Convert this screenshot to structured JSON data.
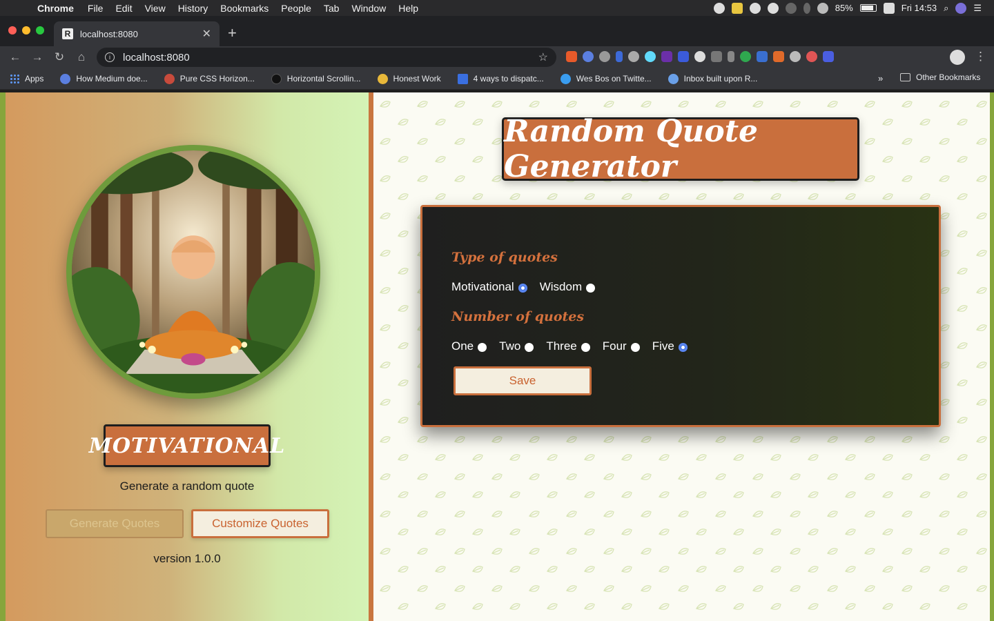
{
  "menubar": {
    "app_name": "Chrome",
    "items": [
      "File",
      "Edit",
      "View",
      "History",
      "Bookmarks",
      "People",
      "Tab",
      "Window",
      "Help"
    ],
    "battery_percent": "85%",
    "clock": "Fri 14:53"
  },
  "browser": {
    "tab_title": "localhost:8080",
    "tab_favicon": "R",
    "url": "localhost:8080",
    "bookmarks": [
      {
        "label": "Apps",
        "color": "#5e97f6"
      },
      {
        "label": "How Medium doe...",
        "color": "#5b7fe0"
      },
      {
        "label": "Pure CSS Horizon...",
        "color": "#c84b3c"
      },
      {
        "label": "Horizontal Scrollin...",
        "color": "#111111"
      },
      {
        "label": "Honest Work",
        "color": "#e8b83a"
      },
      {
        "label": "4 ways to dispatc...",
        "color": "#3a6fe0"
      },
      {
        "label": "Wes Bos on Twitte...",
        "color": "#3a9df0"
      },
      {
        "label": "Inbox built upon R...",
        "color": "#6aa0e8"
      }
    ],
    "other_bookmarks": "Other Bookmarks",
    "more_bookmarks_icon": "»"
  },
  "sidebar": {
    "category_badge": "Motivational",
    "tagline": "Generate a random quote",
    "generate_button": "Generate Quotes",
    "customize_button": "Customize Quotes",
    "version": "version 1.0.0"
  },
  "main": {
    "title": "Random Quote Generator",
    "type_label": "Type of quotes",
    "type_options": [
      {
        "label": "Motivational",
        "selected": true
      },
      {
        "label": "Wisdom",
        "selected": false
      }
    ],
    "number_label": "Number of quotes",
    "number_options": [
      {
        "label": "One",
        "selected": false
      },
      {
        "label": "Two",
        "selected": false
      },
      {
        "label": "Three",
        "selected": false
      },
      {
        "label": "Four",
        "selected": false
      },
      {
        "label": "Five",
        "selected": true
      }
    ],
    "save_button": "Save"
  },
  "colors": {
    "accent": "#c96f3d",
    "green_border": "#86a53c",
    "radio_selected": "#3f6fe0"
  }
}
